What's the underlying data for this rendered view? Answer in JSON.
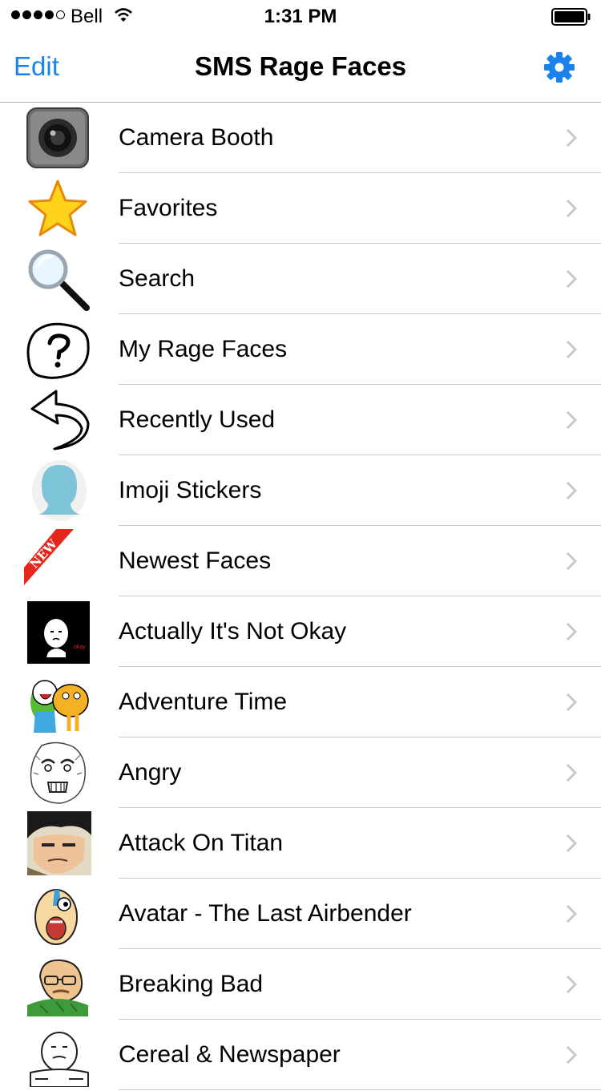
{
  "status_bar": {
    "carrier": "Bell",
    "time": "1:31 PM",
    "signal_strength": 4,
    "signal_max": 5
  },
  "nav": {
    "edit_label": "Edit",
    "title": "SMS Rage Faces",
    "settings_icon": "gear-icon",
    "accent_color": "#1a82ea"
  },
  "list": {
    "items": [
      {
        "label": "Camera Booth",
        "icon": "camera-icon"
      },
      {
        "label": "Favorites",
        "icon": "star-icon"
      },
      {
        "label": "Search",
        "icon": "magnifier-icon"
      },
      {
        "label": "My Rage Faces",
        "icon": "question-bubble-icon"
      },
      {
        "label": "Recently Used",
        "icon": "back-arrow-icon"
      },
      {
        "label": "Imoji Stickers",
        "icon": "head-silhouette-icon"
      },
      {
        "label": "Newest Faces",
        "icon": "new-ribbon-icon",
        "ribbon_text": "NEW"
      },
      {
        "label": "Actually It's Not Okay",
        "icon": "okay-face-icon",
        "caption": "okay"
      },
      {
        "label": "Adventure Time",
        "icon": "adventure-time-icon"
      },
      {
        "label": "Angry",
        "icon": "angry-face-icon"
      },
      {
        "label": "Attack On Titan",
        "icon": "titan-face-icon"
      },
      {
        "label": "Avatar - The Last Airbender",
        "icon": "avatar-face-icon"
      },
      {
        "label": "Breaking Bad",
        "icon": "breaking-bad-face-icon"
      },
      {
        "label": "Cereal & Newspaper",
        "icon": "cereal-guy-icon"
      }
    ]
  }
}
